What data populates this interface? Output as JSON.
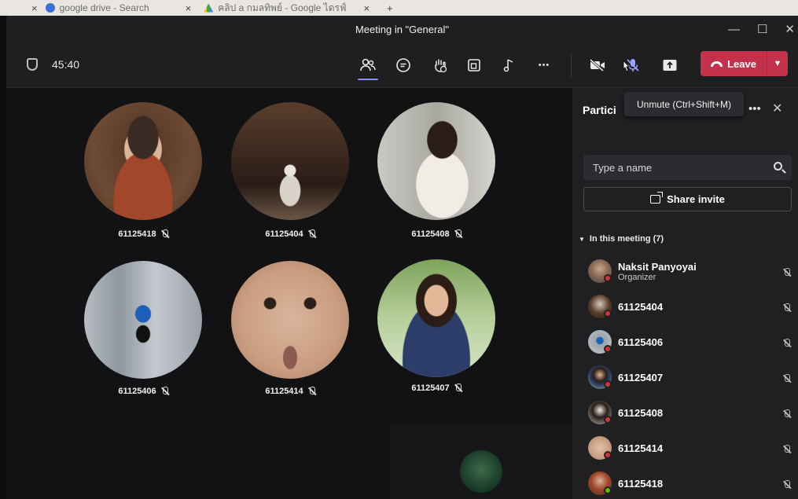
{
  "browser": {
    "tabs": [
      {
        "label": "google drive - Search",
        "close": "×"
      },
      {
        "label": "คลิป a กมลทิพย์ - Google ไดรฟ์",
        "close": "×"
      }
    ],
    "new_tab": "+"
  },
  "window": {
    "title": "Meeting in \"General\"",
    "minimize": "—",
    "maximize": "☐",
    "close": "✕"
  },
  "toolbar": {
    "timer": "45:40",
    "leave_label": "Leave",
    "more": "•••"
  },
  "tooltip": {
    "text": "Unmute (Ctrl+Shift+M)"
  },
  "tiles": [
    {
      "name": "61125418"
    },
    {
      "name": "61125404"
    },
    {
      "name": "61125408"
    },
    {
      "name": "61125406"
    },
    {
      "name": "61125414"
    },
    {
      "name": "61125407"
    }
  ],
  "panel": {
    "title": "Partici",
    "more": "•••",
    "close": "✕",
    "search_placeholder": "Type a name",
    "share_label": "Share invite",
    "section_label": "In this meeting (7)",
    "participants": [
      {
        "name": "Naksit Panyoyai",
        "role": "Organizer",
        "status": "busy"
      },
      {
        "name": "61125404",
        "status": "busy"
      },
      {
        "name": "61125406",
        "status": "busy"
      },
      {
        "name": "61125407",
        "status": "busy"
      },
      {
        "name": "61125408",
        "status": "busy"
      },
      {
        "name": "61125414",
        "status": "busy"
      },
      {
        "name": "61125418",
        "status": "available"
      }
    ]
  },
  "colors": {
    "accent": "#8b8df2",
    "leave": "#c4314b",
    "busy": "#d13438",
    "available": "#6bb700"
  }
}
